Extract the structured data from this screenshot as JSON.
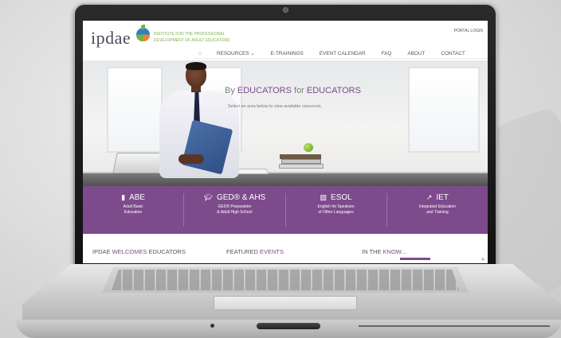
{
  "site": {
    "logo_text": "ipdae",
    "tagline_line1": "INSTITUTE FOR THE PROFESSIONAL",
    "tagline_line2": "DEVELOPMENT OF ADULT EDUCATORS",
    "portal_login": "PORTAL LOGIN"
  },
  "nav": {
    "home_icon": "home-icon",
    "items": [
      {
        "label": "RESOURCES ⌄"
      },
      {
        "label": "E-TRAININGS"
      },
      {
        "label": "EVENT CALENDAR"
      },
      {
        "label": "FAQ"
      },
      {
        "label": "ABOUT"
      },
      {
        "label": "CONTACT"
      }
    ]
  },
  "hero": {
    "tagline_pre": "By ",
    "tagline_word1": "EDUCATORS",
    "tagline_mid": " for ",
    "tagline_word2": "EDUCATORS",
    "subtitle": "Select an area below to view available resources."
  },
  "areas": [
    {
      "icon": "book-icon",
      "title": "ABE",
      "desc1": "Adult Basic",
      "desc2": "Education"
    },
    {
      "icon": "graduation-cap-icon",
      "title": "GED® & AHS",
      "desc1": "GED® Preparation",
      "desc2": "& Adult High School"
    },
    {
      "icon": "language-icon",
      "title": "ESOL",
      "desc1": "English for Speakers",
      "desc2": "of Other Languages"
    },
    {
      "icon": "external-link-icon",
      "title": "IET",
      "desc1": "Integrated Education",
      "desc2": "and Training"
    }
  ],
  "welcome": {
    "col1_pre": "IPDAE ",
    "col1_accent": "WELCOMES",
    "col1_post": " EDUCATORS",
    "col2_pre": "FEATURED ",
    "col2_accent": "EVENTS",
    "col3_pre": "IN THE ",
    "col3_accent": "KNOW..."
  },
  "colors": {
    "brand_purple": "#7d4a8c",
    "brand_green": "#7cb342"
  }
}
